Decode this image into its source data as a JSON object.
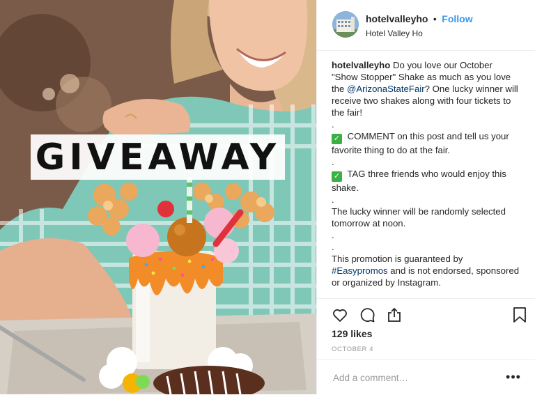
{
  "post": {
    "username": "hotelvalleyho",
    "separator": "•",
    "follow_label": "Follow",
    "location": "Hotel Valley Ho",
    "overlay_text": "GIVEAWAY",
    "caption": {
      "user": "hotelvalleyho",
      "intro_1": " Do you love our October \"Show Stopper\" Shake as much as you love the ",
      "mention": "@ArizonaStateFair",
      "intro_2": "? One lucky winner will receive two shakes along with four tickets to the fair!",
      "dot1": ".",
      "check1": "✓",
      "step1": " COMMENT on this post and tell us your favorite thing to do at the fair.",
      "dot2": ".",
      "check2": "✓",
      "step2": " TAG three friends who would enjoy this shake.",
      "dot3": ".",
      "winner": "The lucky winner will be randomly selected tomorrow at noon.",
      "dot4": ".",
      "dot5": ".",
      "promo_1": "This promotion is guaranteed by ",
      "hashtag": "#Easypromos",
      "promo_2": " and is not endorsed, sponsored or organized by Instagram.",
      "dot6": "."
    },
    "likes": "129 likes",
    "date": "OCTOBER 4",
    "comment_placeholder": "Add a comment…",
    "more_label": "•••"
  },
  "icons": [
    "heart-icon",
    "comment-icon",
    "share-icon",
    "bookmark-icon"
  ],
  "colors": {
    "link": "#003569",
    "follow": "#3897f0",
    "check": "#3bb143",
    "muted": "#999999"
  }
}
